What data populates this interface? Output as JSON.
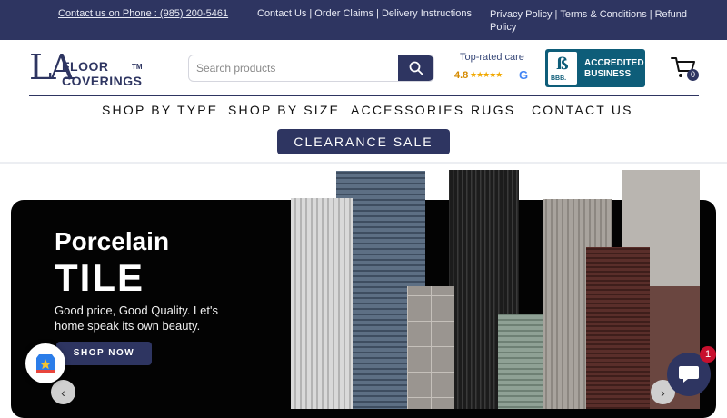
{
  "topbar": {
    "phone": "Contact us on Phone : (985) 200-5461",
    "links_mid": [
      "Contact Us",
      "Order Claims",
      "Delivery Instructions"
    ],
    "links_right": [
      "Privacy Policy",
      "Terms & Conditions",
      "Refund Policy"
    ],
    "separator": "|",
    "bg_color": "#2e3561"
  },
  "logo": {
    "monogram": "LA",
    "line1": "FLOOR",
    "line2": "COVERINGS",
    "tm": "TM"
  },
  "search": {
    "placeholder": "Search products",
    "value": "",
    "icon": "search-icon"
  },
  "rating": {
    "label": "Top-rated care",
    "score": "4.8",
    "stars": "★★★★★",
    "provider_icon": "G"
  },
  "bbb": {
    "seal_text": "BBB",
    "seal_sub": "BBB.",
    "line1": "ACCREDITED",
    "line2": "BUSINESS"
  },
  "cart": {
    "icon": "cart-icon",
    "count": "0"
  },
  "nav": {
    "items": [
      "SHOP BY TYPE",
      "SHOP BY SIZE",
      "ACCESSORIES",
      "RUGS",
      "CONTACT US"
    ],
    "clearance": "CLEARANCE SALE"
  },
  "hero": {
    "title_line1": "Porcelain",
    "title_line2": "TILE",
    "description": "Good price, Good Quality. Let's home speak its own beauty.",
    "cta": "SHOP NOW",
    "prev_icon": "chevron-left-icon",
    "next_icon": "chevron-right-icon",
    "prev_glyph": "‹",
    "next_glyph": "›"
  },
  "widgets": {
    "review_icon": "review-badge-icon",
    "chat_icon": "chat-icon",
    "chat_badge": "1"
  },
  "colors": {
    "brand": "#2e3561",
    "hero_bg": "#030303",
    "badge_red": "#c8102e"
  }
}
